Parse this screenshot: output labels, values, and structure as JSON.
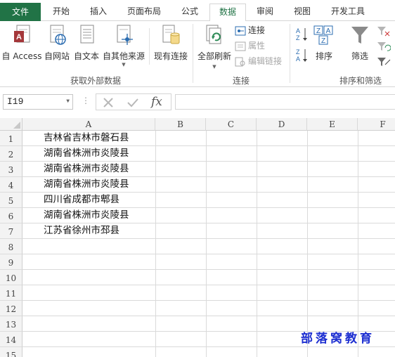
{
  "tabs": [
    {
      "label": "文件"
    },
    {
      "label": "开始"
    },
    {
      "label": "插入"
    },
    {
      "label": "页面布局"
    },
    {
      "label": "公式"
    },
    {
      "label": "数据"
    },
    {
      "label": "审阅"
    },
    {
      "label": "视图"
    },
    {
      "label": "开发工具"
    }
  ],
  "active_tab": "数据",
  "ribbon": {
    "get_external": {
      "access": "自 Access",
      "web": "自网站",
      "text": "自文本",
      "other": "自其他来源",
      "label": "获取外部数据"
    },
    "existing": "现有连接",
    "refresh_all": "全部刷新",
    "connections": {
      "connect": "连接",
      "properties": "属性",
      "edit_links": "编辑链接",
      "label": "连接"
    },
    "sort": {
      "sort": "排序",
      "filter": "筛选",
      "label": "排序和筛选"
    }
  },
  "formula_bar": {
    "name_box": "I19",
    "fx": "fx",
    "value": ""
  },
  "columns": [
    "A",
    "B",
    "C",
    "D",
    "E",
    "F"
  ],
  "rows": [
    "1",
    "2",
    "3",
    "4",
    "5",
    "6",
    "7",
    "8",
    "9",
    "10",
    "11",
    "12",
    "13",
    "14",
    "15"
  ],
  "cells_a": [
    "吉林省吉林市磐石县",
    "湖南省株洲市炎陵县",
    "湖南省株洲市炎陵县",
    "湖南省株洲市炎陵县",
    "四川省成都市郫县",
    "湖南省株洲市炎陵县",
    "江苏省徐州市邳县"
  ],
  "watermark": "部落窝教育",
  "colors": {
    "file_tab": "#217346",
    "watermark": "#1d2fd1"
  }
}
